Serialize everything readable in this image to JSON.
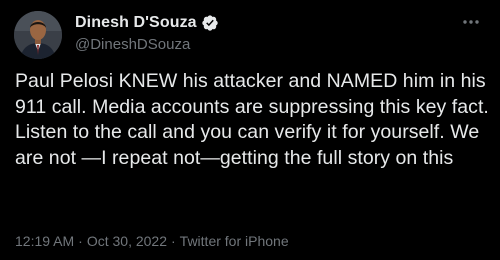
{
  "author": {
    "display_name": "Dinesh D'Souza",
    "handle": "@DineshDSouza",
    "verified": true
  },
  "tweet": {
    "text": "Paul Pelosi KNEW his attacker and NAMED him in his 911 call. Media accounts are suppressing this key fact. Listen to the call and you can verify it for yourself. We are not —I repeat not—getting the full story on this"
  },
  "meta": {
    "time": "12:19 AM",
    "separator": "·",
    "date": "Oct 30, 2022",
    "source": "Twitter for iPhone"
  },
  "icons": {
    "verified": "verified-badge-icon",
    "more": "more-options-icon"
  },
  "colors": {
    "background": "#000000",
    "text_primary": "#e7e9ea",
    "text_secondary": "#71767b",
    "verified_badge": "#1d9bf0"
  }
}
